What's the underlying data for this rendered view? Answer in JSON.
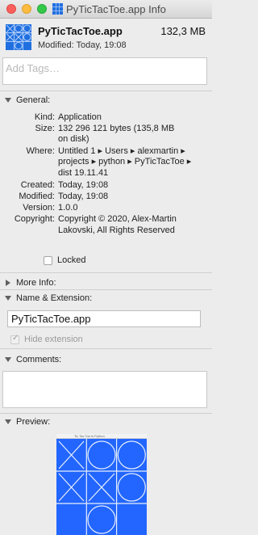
{
  "window": {
    "title": "PyTicTacToe.app Info"
  },
  "header": {
    "name": "PyTicTacToe.app",
    "size": "132,3 MB",
    "modified": "Modified: Today, 19:08"
  },
  "tags": {
    "placeholder": "Add Tags…"
  },
  "general": {
    "label": "General:",
    "kind_label": "Kind:",
    "kind": "Application",
    "size_label": "Size:",
    "size_line1": "132 296 121 bytes (135,8 MB",
    "size_line2": "on disk)",
    "where_label": "Where:",
    "where_line1": "Untitled 1 ▸ Users ▸ alexmartin ▸",
    "where_line2": "projects ▸ python ▸ PyTicTacToe ▸",
    "where_line3": "dist 19.11.41",
    "created_label": "Created:",
    "created": "Today, 19:08",
    "modified_label": "Modified:",
    "modified": "Today, 19:08",
    "version_label": "Version:",
    "version": "1.0.0",
    "copyright_label": "Copyright:",
    "copyright_line1": "Copyright © 2020, Alex-Martin",
    "copyright_line2": "Lakovski, All Rights Reserved",
    "locked_label": "Locked"
  },
  "more_info": {
    "label": "More Info:"
  },
  "name_ext": {
    "label": "Name & Extension:",
    "value": "PyTicTacToe.app",
    "hide_label": "Hide extension"
  },
  "comments": {
    "label": "Comments:"
  },
  "preview": {
    "label": "Preview:",
    "window_title": "Tic Tac Toe in Python"
  },
  "colors": {
    "preview_blue": "#2266ff",
    "icon_blue": "#1f6fe0"
  }
}
